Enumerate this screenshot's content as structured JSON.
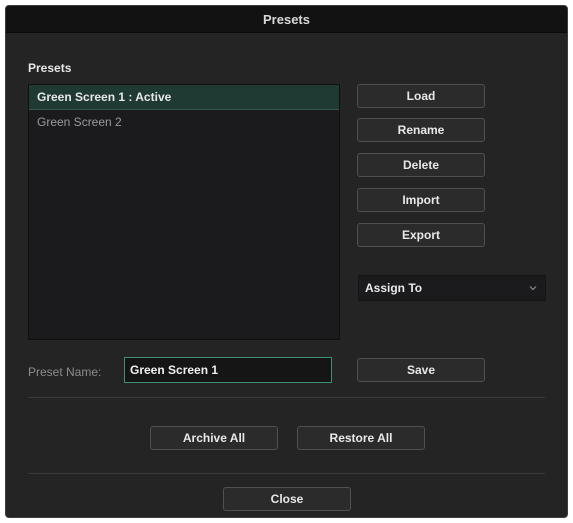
{
  "dialog": {
    "title": "Presets"
  },
  "presets": {
    "label": "Presets",
    "items": [
      {
        "label": "Green Screen 1 : Active",
        "selected": true
      },
      {
        "label": "Green Screen 2",
        "selected": false
      }
    ]
  },
  "actions": {
    "load": "Load",
    "rename": "Rename",
    "delete": "Delete",
    "import": "Import",
    "export": "Export"
  },
  "assign": {
    "label": "Assign To",
    "icon": "chevron-down-icon"
  },
  "preset_name": {
    "label": "Preset Name:",
    "value": "Green Screen 1"
  },
  "save_label": "Save",
  "footer": {
    "archive_all": "Archive All",
    "restore_all": "Restore All",
    "close": "Close"
  },
  "colors": {
    "dialog_bg": "#242424",
    "titlebar_bg": "#121212",
    "selection_bg": "#1f3a33",
    "input_border": "#3f8f72"
  }
}
